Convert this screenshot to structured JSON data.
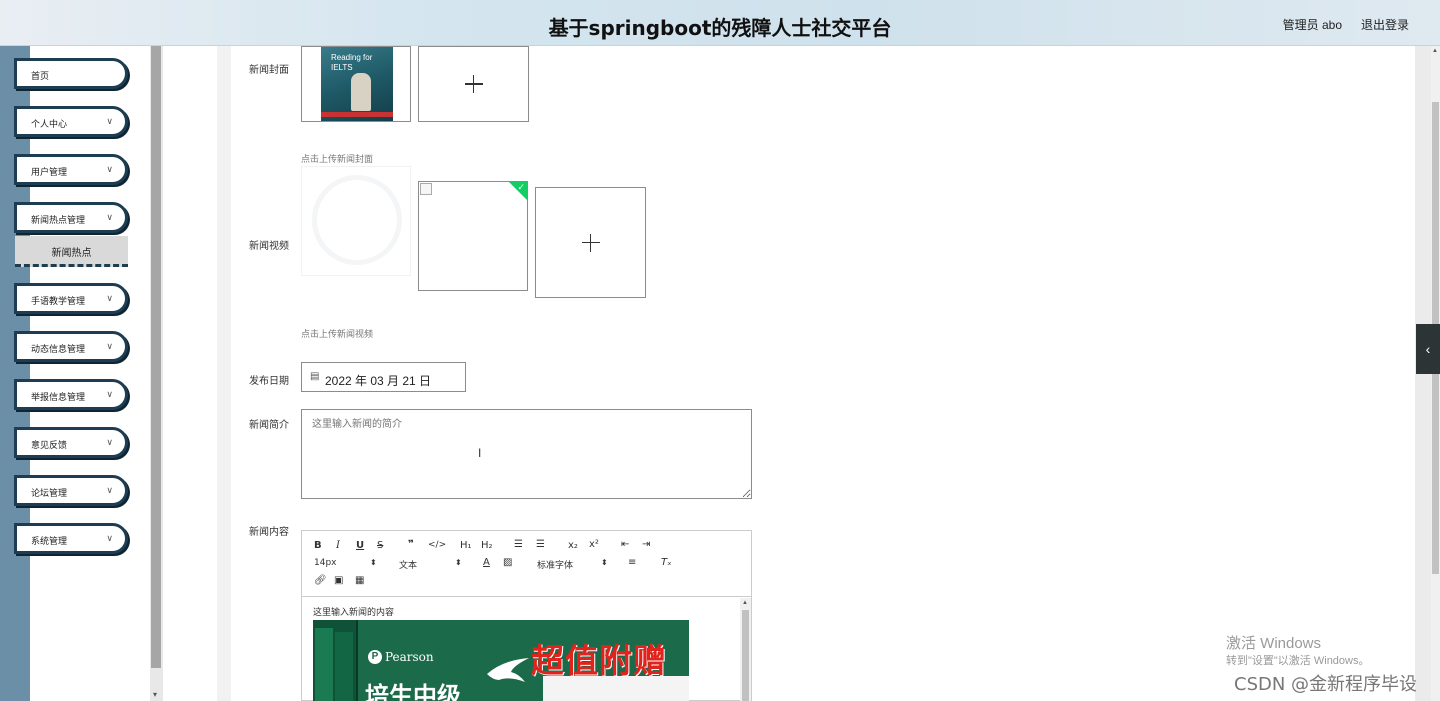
{
  "header": {
    "title": "基于springboot的残障人士社交平台",
    "user_label": "管理员 abo",
    "logout_label": "退出登录"
  },
  "sidebar": {
    "items": [
      {
        "label": "首页",
        "has_chevron": false
      },
      {
        "label": "个人中心",
        "has_chevron": true
      },
      {
        "label": "用户管理",
        "has_chevron": true
      },
      {
        "label": "新闻热点管理",
        "has_chevron": true
      },
      {
        "label": "手语教学管理",
        "has_chevron": true
      },
      {
        "label": "动态信息管理",
        "has_chevron": true
      },
      {
        "label": "举报信息管理",
        "has_chevron": true
      },
      {
        "label": "意见反馈",
        "has_chevron": true
      },
      {
        "label": "论坛管理",
        "has_chevron": true
      },
      {
        "label": "系统管理",
        "has_chevron": true
      }
    ],
    "active_submenu": "新闻热点"
  },
  "form": {
    "cover_label": "新闻封面",
    "cover_hint": "点击上传新闻封面",
    "cover_book_title": "Reading for IELTS",
    "video_label": "新闻视频",
    "video_hint": "点击上传新闻视频",
    "date_label": "发布日期",
    "date_value": "2022 年 03 月 21 日",
    "intro_label": "新闻简介",
    "intro_placeholder": "这里输入新闻的简介",
    "content_label": "新闻内容"
  },
  "editor": {
    "font_size": "14px",
    "block_type": "文本",
    "font_family": "标准字体",
    "content_placeholder": "这里输入新闻的内容",
    "promo": {
      "brand": "Pearson",
      "cn_text": "培生中级",
      "red_text": "超值附赠"
    }
  },
  "watermark": {
    "line1": "激活 Windows",
    "line2": "转到\"设置\"以激活 Windows。",
    "csdn": "CSDN @金新程序毕设"
  },
  "colors": {
    "sidebar_rail": "#6b8fa6",
    "menu_border": "#1e3d52",
    "success_badge": "#13ce66"
  }
}
